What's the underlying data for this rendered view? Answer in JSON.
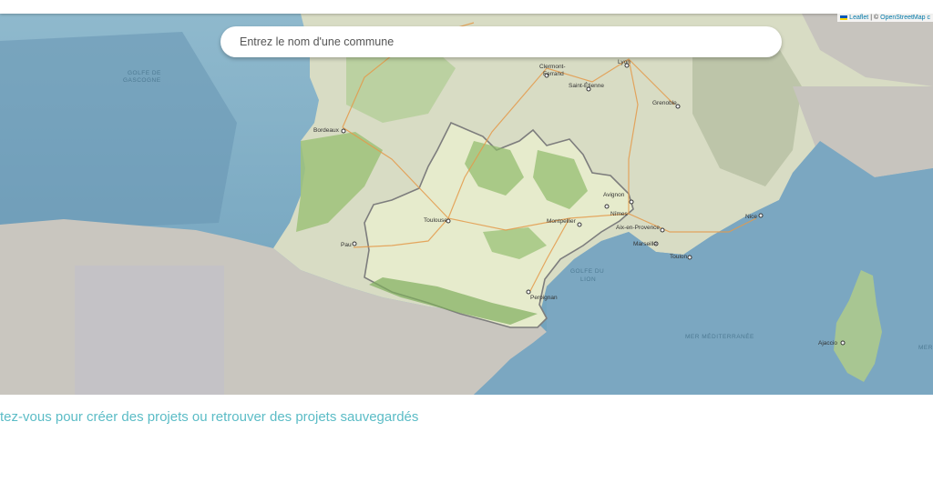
{
  "search": {
    "placeholder": "Entrez le nom d'une commune"
  },
  "attribution": {
    "leaflet": "Leaflet",
    "separator": "| ©",
    "osm": "OpenStreetMap c"
  },
  "map": {
    "seas": [
      "GOLFE DE",
      "GASCOGNE",
      "GOLFE DU",
      "LION",
      "MER MÉDITERRANÉE",
      "MER"
    ],
    "cities": [
      "Clermont-",
      "Ferrand",
      "Lyon",
      "Saint-Étienne",
      "Grenoble",
      "Bordeaux",
      "Toulouse",
      "Montpellier",
      "Nîmes",
      "Avignon",
      "Aix-en-Provence",
      "Marseille",
      "Toulon",
      "Pau",
      "Perpignan",
      "Ajaccio",
      "Nice"
    ],
    "highlighted_region": "Occitanie"
  },
  "cta": {
    "text": "tez-vous pour créer des projets ou retrouver des projets sauvegardés"
  }
}
